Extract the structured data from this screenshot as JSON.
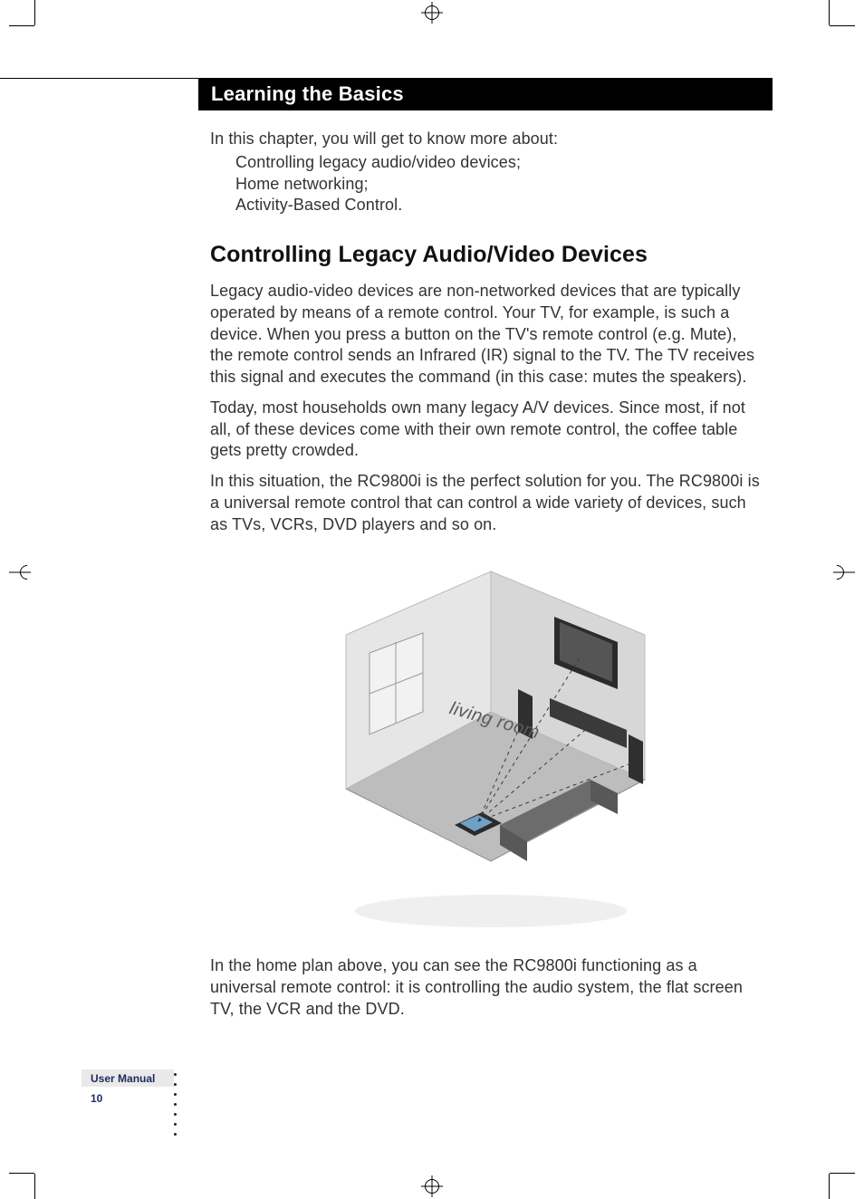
{
  "header": {
    "title": "Learning the Basics"
  },
  "intro": {
    "lead": "In this chapter, you will get to know more about:",
    "bullets": [
      "Controlling legacy audio/video devices;",
      "Home networking;",
      "Activity-Based Control."
    ]
  },
  "section": {
    "heading": "Controlling Legacy Audio/Video Devices",
    "p1": "Legacy audio-video devices are non-networked devices that are typically operated by means of a remote control. Your TV, for example, is such a device. When you press a button on the TV's remote control (e.g. Mute), the remote control sends an Infrared (IR) signal to the TV. The TV receives this signal and executes the command (in this case: mutes the speakers).",
    "p2": "Today, most households own many legacy A/V devices. Since most, if not all, of these devices come with their own remote control, the coffee table gets pretty crowded.",
    "p3": "In this situation, the RC9800i is the perfect solution for you. The RC9800i is a universal remote control that can control a wide variety of devices, such as TVs, VCRs, DVD players and so on.",
    "illustration_label": "living room",
    "caption": "In the home plan above, you can see the RC9800i functioning as a universal remote control: it is controlling the audio system, the flat screen TV, the VCR and the DVD."
  },
  "footer": {
    "label": "User Manual",
    "page": "10"
  }
}
